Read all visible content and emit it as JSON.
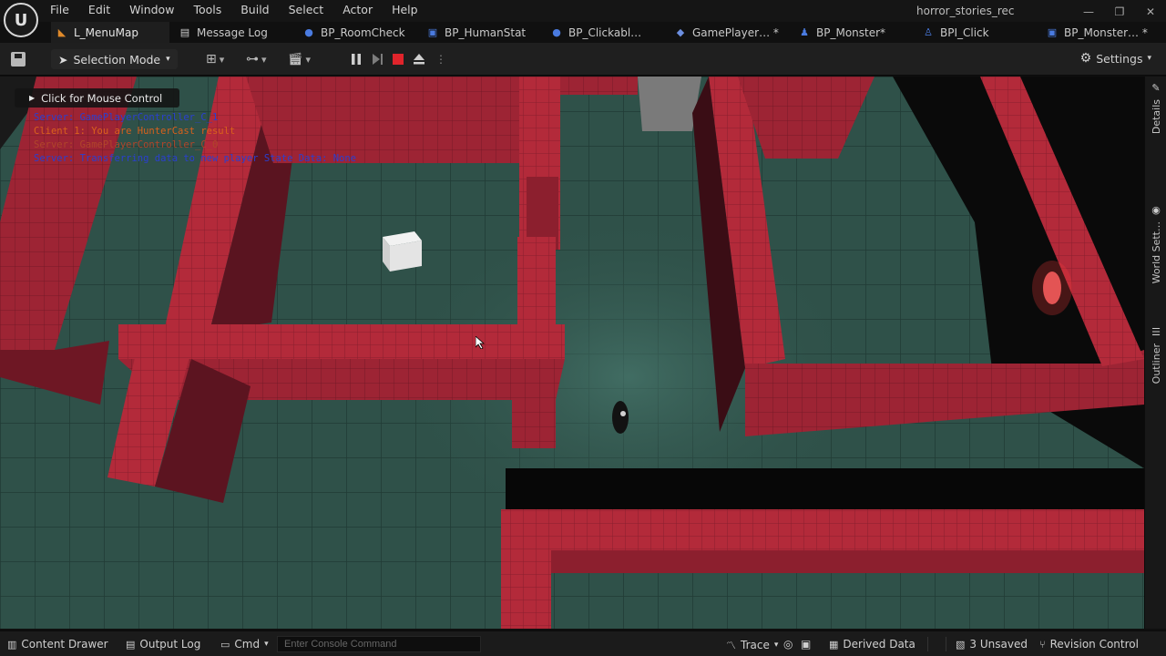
{
  "menubar": {
    "logo_text": "U",
    "items": [
      "File",
      "Edit",
      "Window",
      "Tools",
      "Build",
      "Select",
      "Actor",
      "Help"
    ],
    "project_title": "horror_stories_rec",
    "window_controls": [
      "—",
      "❐",
      "✕"
    ]
  },
  "tabs": [
    {
      "label": "L_MenuMap",
      "icon": "level-icon",
      "active": true
    },
    {
      "label": "Message Log",
      "icon": "log-icon"
    },
    {
      "label": "BP_RoomCheck",
      "icon": "blueprint-icon"
    },
    {
      "label": "BP_HumanStat",
      "icon": "blueprint-icon"
    },
    {
      "label": "BP_Clickabl…",
      "icon": "blueprint-icon"
    },
    {
      "label": "GamePlayer… *",
      "icon": "gamepad-icon"
    },
    {
      "label": "BP_Monster*",
      "icon": "character-icon"
    },
    {
      "label": "BPI_Click",
      "icon": "interface-icon"
    },
    {
      "label": "BP_Monster… *",
      "icon": "blueprint-icon"
    }
  ],
  "toolbar": {
    "selection_mode": "Selection Mode",
    "settings": "Settings"
  },
  "viewport": {
    "mouse_control": "Click for Mouse Control",
    "debug_lines": [
      {
        "text": "Server: GamePlayerController_C_1",
        "color": "#2a3fd0"
      },
      {
        "text": "Client 1: You are HunterCast result",
        "color": "#d9611c"
      },
      {
        "text": "Server: GamePlayerController_C_0",
        "color": "#b0452a"
      },
      {
        "text": "Server: Transferring data to new player State Data: None",
        "color": "#2a3fd0"
      }
    ],
    "colors": {
      "floor": "#2f5149",
      "wall_top": "#b32a3a",
      "wall_side": "#8c1f2e",
      "void": "#0a0a0a"
    }
  },
  "side_panel": [
    "Details",
    "World Sett…",
    "Outliner"
  ],
  "statusbar": {
    "content_drawer": "Content Drawer",
    "output_log": "Output Log",
    "cmd": "Cmd",
    "console_placeholder": "Enter Console Command",
    "trace": "Trace",
    "derived_data": "Derived Data",
    "unsaved": "3 Unsaved",
    "revision_control": "Revision Control"
  }
}
